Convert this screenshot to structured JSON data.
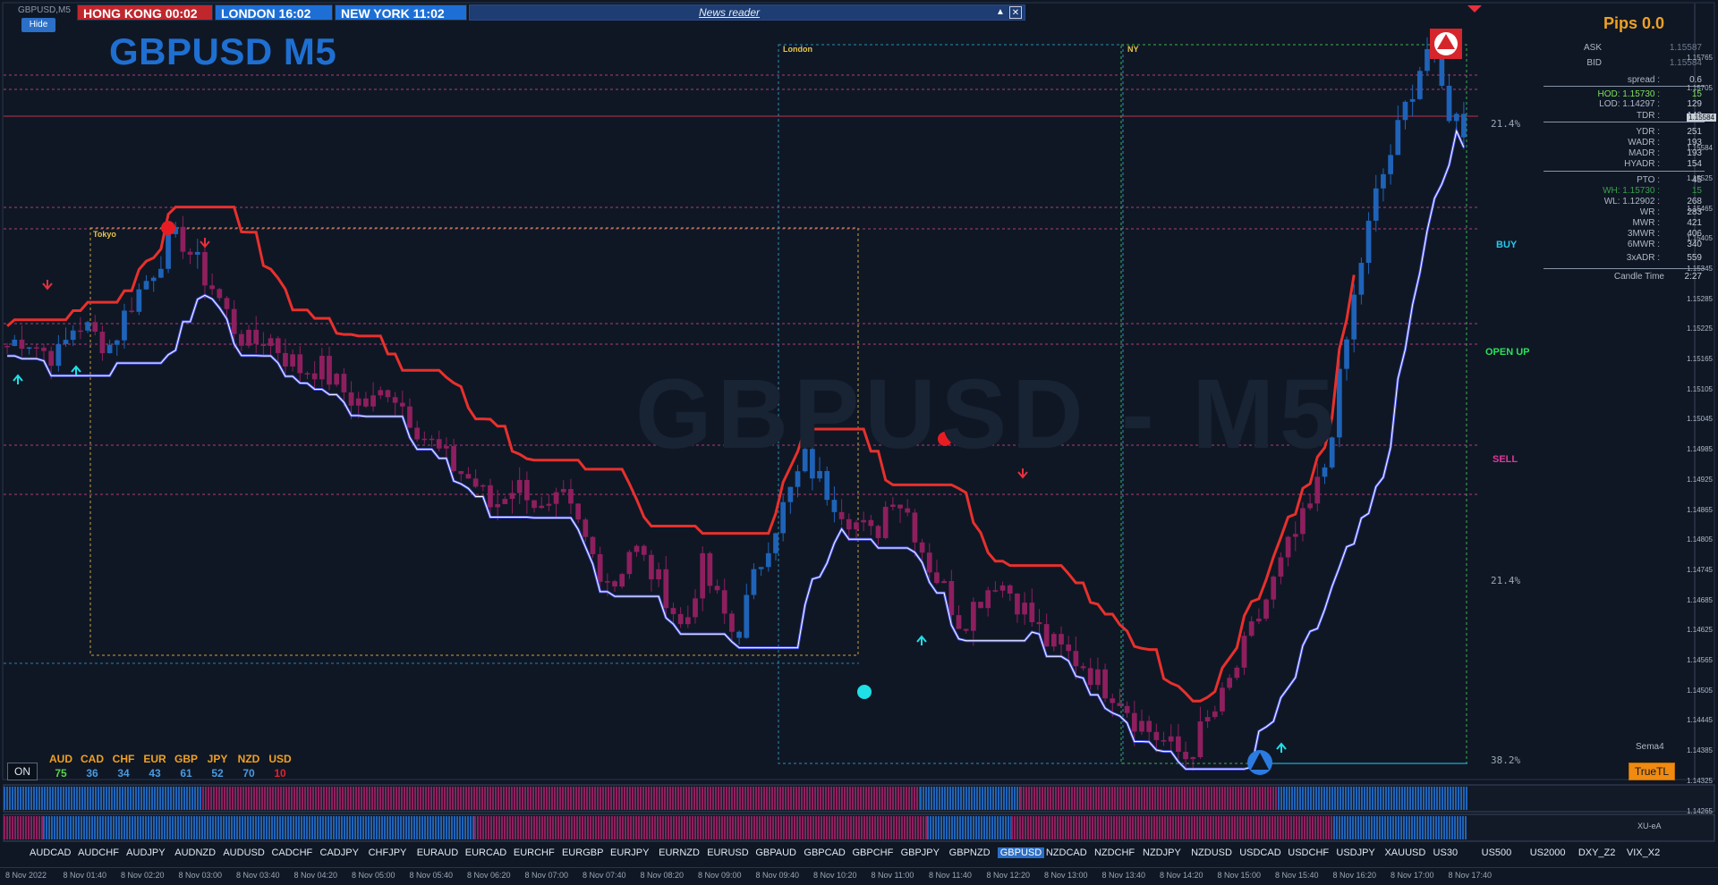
{
  "window": {
    "title": "GBPUSD,M5",
    "hide_label": "Hide"
  },
  "clocks": [
    {
      "label": "HONG KONG 00:02",
      "color": "#c0272d"
    },
    {
      "label": "LONDON   16:02",
      "color": "#1d6fd6"
    },
    {
      "label": "NEW YORK  11:02",
      "color": "#1d6fd6"
    }
  ],
  "news": {
    "title": "News reader",
    "minimize": "▲",
    "close": "✕"
  },
  "symbol_label": "GBPUSD M5",
  "watermark": "GBPUSD - M5",
  "pips": "Pips 0.0",
  "info": [
    {
      "k": "ASK",
      "v": "1.15587"
    },
    {
      "k": "BID",
      "v": "1.15584"
    },
    {
      "k": "spread :",
      "v": "0.6"
    },
    {
      "k": "HOD: 1.15730 :",
      "v": "15",
      "color": "#7ee05a"
    },
    {
      "k": "LOD: 1.14297 :",
      "v": "129"
    },
    {
      "k": "TDR :",
      "v": "143"
    },
    {
      "k": "YDR :",
      "v": "251"
    },
    {
      "k": "WADR :",
      "v": "193"
    },
    {
      "k": "MADR :",
      "v": "193"
    },
    {
      "k": "HYADR :",
      "v": "154"
    },
    {
      "k": "PTO :",
      "v": "45"
    },
    {
      "k": "WH: 1.15730 :",
      "v": "15",
      "color": "#3aa04a"
    },
    {
      "k": "WL: 1.12902 :",
      "v": "268"
    },
    {
      "k": "WR :",
      "v": "283"
    },
    {
      "k": "MWR :",
      "v": "421"
    },
    {
      "k": "3MWR :",
      "v": "406"
    },
    {
      "k": "6MWR :",
      "v": "340"
    },
    {
      "k": "3xADR :",
      "v": "559"
    },
    {
      "k": "Candle Time",
      "v": "2:27"
    }
  ],
  "signals": {
    "buy": "BUY",
    "open_up": "OPEN UP",
    "sell": "SELL"
  },
  "fib": {
    "top": "21.4%",
    "mid": "21.4%",
    "bottom": "38.2%"
  },
  "sessions": {
    "tokyo": "Tokyo",
    "london": "London",
    "ny": "NY"
  },
  "currencies": [
    {
      "c": "AUD",
      "v": "75",
      "color": "#f0a022",
      "vcolor": "#58d34a"
    },
    {
      "c": "CAD",
      "v": "36",
      "color": "#f0a022",
      "vcolor": "#4a9be0"
    },
    {
      "c": "CHF",
      "v": "34",
      "color": "#f0a022",
      "vcolor": "#4a9be0"
    },
    {
      "c": "EUR",
      "v": "43",
      "color": "#f0a022",
      "vcolor": "#4a9be0"
    },
    {
      "c": "GBP",
      "v": "61",
      "color": "#f0a022",
      "vcolor": "#4a9be0"
    },
    {
      "c": "JPY",
      "v": "52",
      "color": "#f0a022",
      "vcolor": "#4a9be0"
    },
    {
      "c": "NZD",
      "v": "70",
      "color": "#f0a022",
      "vcolor": "#4a9be0"
    },
    {
      "c": "USD",
      "v": "10",
      "color": "#f0a022",
      "vcolor": "#e0242e"
    }
  ],
  "on_label": "ON",
  "truetl_label": "TrueTL",
  "sema_label": "Sema4",
  "xuea_label": "XU-eA",
  "pairs": [
    "AUDCAD",
    "AUDCHF",
    "AUDJPY",
    "AUDNZD",
    "AUDUSD",
    "CADCHF",
    "CADJPY",
    "CHFJPY",
    "EURAUD",
    "EURCAD",
    "EURCHF",
    "EURGBP",
    "EURJPY",
    "EURNZD",
    "EURUSD",
    "GBPAUD",
    "GBPCAD",
    "GBPCHF",
    "GBPJPY",
    "GBPNZD",
    "GBPUSD",
    "NZDCAD",
    "NZDCHF",
    "NZDJPY",
    "NZDUSD",
    "USDCAD",
    "USDCHF",
    "USDJPY",
    "XAUUSD",
    "US30",
    "US500",
    "US2000",
    "DXY_Z2",
    "VIX_X2"
  ],
  "active_pair": "GBPUSD",
  "price_labels": [
    "1.15765",
    "1.15705",
    "1.15645",
    "1.15584",
    "1.15525",
    "1.15465",
    "1.15405",
    "1.15345",
    "1.15285",
    "1.15225",
    "1.15165",
    "1.15105",
    "1.15045",
    "1.14985",
    "1.14925",
    "1.14865",
    "1.14805",
    "1.14745",
    "1.14685",
    "1.14625",
    "1.14565",
    "1.14505",
    "1.14445",
    "1.14385",
    "1.14325",
    "1.14265"
  ],
  "current_price": "1.15584",
  "time_labels": [
    "8 Nov 2022",
    "8 Nov 01:40",
    "8 Nov 02:20",
    "8 Nov 03:00",
    "8 Nov 03:40",
    "8 Nov 04:20",
    "8 Nov 05:00",
    "8 Nov 05:40",
    "8 Nov 06:20",
    "8 Nov 07:00",
    "8 Nov 07:40",
    "8 Nov 08:20",
    "8 Nov 09:00",
    "8 Nov 09:40",
    "8 Nov 10:20",
    "8 Nov 11:00",
    "8 Nov 11:40",
    "8 Nov 12:20",
    "8 Nov 13:00",
    "8 Nov 13:40",
    "8 Nov 14:20",
    "8 Nov 15:00",
    "8 Nov 15:40",
    "8 Nov 16:20",
    "8 Nov 17:00",
    "8 Nov 17:40"
  ],
  "chart_data": {
    "type": "candlestick",
    "symbol": "GBPUSD",
    "timeframe": "M5",
    "ylim": [
      1.14265,
      1.15765
    ],
    "close_path": [
      1.1514,
      1.1516,
      1.1513,
      1.1512,
      1.1519,
      1.1516,
      1.1514,
      1.1522,
      1.1527,
      1.1533,
      1.1536,
      1.153,
      1.1525,
      1.1518,
      1.1514,
      1.1516,
      1.1512,
      1.1509,
      1.151,
      1.1506,
      1.1503,
      1.1502,
      1.1506,
      1.1501,
      1.1496,
      1.1492,
      1.1489,
      1.1486,
      1.1481,
      1.1486,
      1.1485,
      1.1479,
      1.1483,
      1.1477,
      1.147,
      1.1466,
      1.1474,
      1.1469,
      1.1464,
      1.1456,
      1.147,
      1.1462,
      1.1455,
      1.1466,
      1.1476,
      1.1483,
      1.1491,
      1.1486,
      1.1482,
      1.1478,
      1.1475,
      1.1485,
      1.148,
      1.1471,
      1.1465,
      1.1458,
      1.1463,
      1.1467,
      1.1464,
      1.1459,
      1.1454,
      1.1452,
      1.145,
      1.1446,
      1.1444,
      1.1439,
      1.1436,
      1.1433,
      1.1431,
      1.1437,
      1.1442,
      1.145,
      1.1458,
      1.1466,
      1.1474,
      1.148,
      1.149,
      1.151,
      1.153,
      1.1545,
      1.1555,
      1.1566,
      1.1575,
      1.1562,
      1.1558
    ]
  }
}
